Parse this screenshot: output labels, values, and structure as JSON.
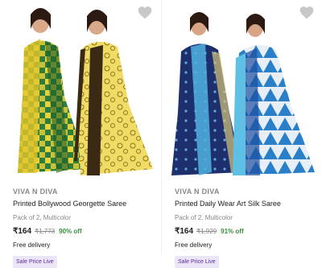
{
  "colors": {
    "offer": "#388e3c",
    "badge_bg": "#ece5f7",
    "badge_text": "#5b2ca0",
    "muted": "#878787"
  },
  "products": [
    {
      "brand": "VIVA N DIVA",
      "title": "Printed Bollywood Georgette Saree",
      "subtitle": "Pack of 2, Multicolor",
      "price": "₹164",
      "mrp": "₹1,773",
      "discount": "90% off",
      "delivery": "Free delivery",
      "badge": "Sale Price Live",
      "wishlist_icon": "heart-icon"
    },
    {
      "brand": "VIVA N DIVA",
      "title": "Printed Daily Wear Art Silk Saree",
      "subtitle": "Pack of 2, Multicolor",
      "price": "₹164",
      "mrp": "₹1,929",
      "discount": "91% off",
      "delivery": "Free delivery",
      "badge": "Sale Price Live",
      "wishlist_icon": "heart-icon"
    }
  ]
}
